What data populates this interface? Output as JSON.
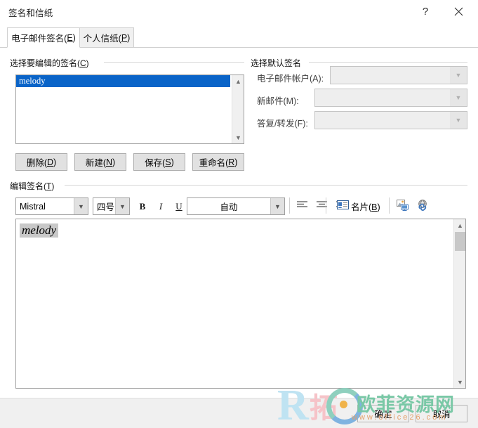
{
  "window": {
    "title": "签名和信纸",
    "help_icon": "?",
    "close_icon": "close-icon"
  },
  "tabs": [
    {
      "label_main": "电子邮件签名(",
      "accel": "E",
      "label_tail": ")",
      "active": true
    },
    {
      "label_main": "个人信纸(",
      "accel": "P",
      "label_tail": ")",
      "active": false
    }
  ],
  "select_signature_group": {
    "label_main": "选择要编辑的签名(",
    "accel": "C",
    "label_tail": ")",
    "list_items": [
      "melody"
    ],
    "selected_index": 0,
    "selected_bg": "#0a64c8",
    "scroll_up_icon": "chevron-up-icon",
    "scroll_down_icon": "chevron-down-icon"
  },
  "action_buttons": [
    {
      "label_main": "删除(",
      "accel": "D",
      "label_tail": ")"
    },
    {
      "label_main": "新建(",
      "accel": "N",
      "label_tail": ")"
    },
    {
      "label_main": "保存(",
      "accel": "S",
      "label_tail": ")"
    },
    {
      "label_main": "重命名(",
      "accel": "R",
      "label_tail": ")"
    }
  ],
  "default_signature_group": {
    "label": "选择默认签名",
    "fields": [
      {
        "label": "电子邮件帐户(A):",
        "value": "",
        "disabled": true
      },
      {
        "label": "新邮件(M):",
        "value": "",
        "disabled": true
      },
      {
        "label": "答复/转发(F):",
        "value": "",
        "disabled": true
      }
    ]
  },
  "edit_signature_group": {
    "label_main": "编辑签名(",
    "accel": "T",
    "label_tail": ")"
  },
  "toolbar": {
    "font_family": "Mistral",
    "font_size": "四号",
    "bold_label": "B",
    "italic_label": "I",
    "underline_label": "U",
    "font_color": "自动",
    "align_left_icon": "align-left-icon",
    "align_center_icon": "align-center-icon",
    "align_right_icon": "align-right-icon",
    "business_card_main": "名片(",
    "business_card_accel": "B",
    "business_card_tail": ")",
    "picture_icon": "insert-picture-icon",
    "hyperlink_icon": "insert-hyperlink-icon",
    "dropdown_icon": "chevron-down-icon"
  },
  "editor": {
    "content": "melody",
    "scroll_up_icon": "chevron-up-icon",
    "scroll_down_icon": "chevron-down-icon"
  },
  "footer": {
    "ok_label": "确定",
    "cancel_label": "取消"
  },
  "watermark": {
    "logo_letter": "R",
    "logo_pink": "拓",
    "brand_cn": "欧菲资源网",
    "url": "www.office26.com"
  }
}
